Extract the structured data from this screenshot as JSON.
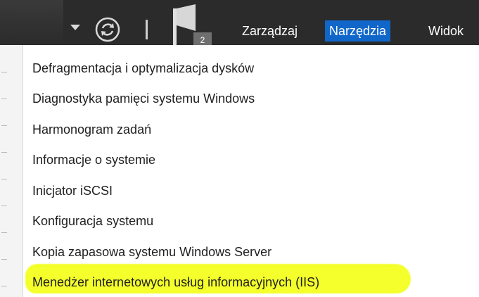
{
  "toolbar": {
    "notifications_count": "2",
    "menus": [
      "Zarządzaj",
      "Narzędzia",
      "Widok"
    ],
    "active_menu": "Narzędzia"
  },
  "dropdown": {
    "items": [
      "Defragmentacja i optymalizacja dysków",
      "Diagnostyka pamięci systemu Windows",
      "Harmonogram zadań",
      "Informacje o systemie",
      "Inicjator iSCSI",
      "Konfiguracja systemu",
      "Kopia zapasowa systemu Windows Server",
      "Menedżer internetowych usług informacyjnych (IIS)"
    ],
    "highlighted_item": "Menedżer internetowych usług informacyjnych (IIS)"
  },
  "colors": {
    "titlebar": "#2b2b2b",
    "active_menu_bg": "#1167c9",
    "highlight_marker": "#f4ff2b",
    "menu_text": "#1f1f1f"
  },
  "icons": [
    "chevron-down-icon",
    "refresh-icon",
    "flag-icon"
  ]
}
